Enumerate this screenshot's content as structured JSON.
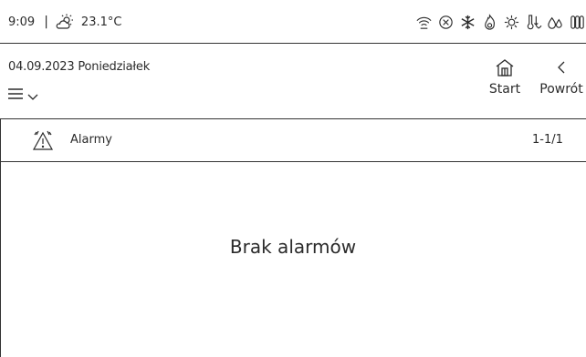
{
  "status": {
    "time": "9:09",
    "separator": "|",
    "temperature": "23.1°C",
    "weather_icon": "partly-sunny-icon",
    "icons": [
      "wifi-icon",
      "cancel-circle-icon",
      "snowflake-icon",
      "flame-icon",
      "sun-gear-icon",
      "thermometer-arrows-icon",
      "drops-icon",
      "radiator-icon"
    ]
  },
  "header": {
    "date": "04.09.2023 Poniedziałek",
    "start_label": "Start",
    "back_label": "Powrót"
  },
  "listbar": {
    "title": "Alarmy",
    "count": "1-1/1"
  },
  "content": {
    "empty_message": "Brak alarmów"
  },
  "colors": {
    "text": "#2b2b2b",
    "background": "#ffffff",
    "border": "#333333"
  }
}
